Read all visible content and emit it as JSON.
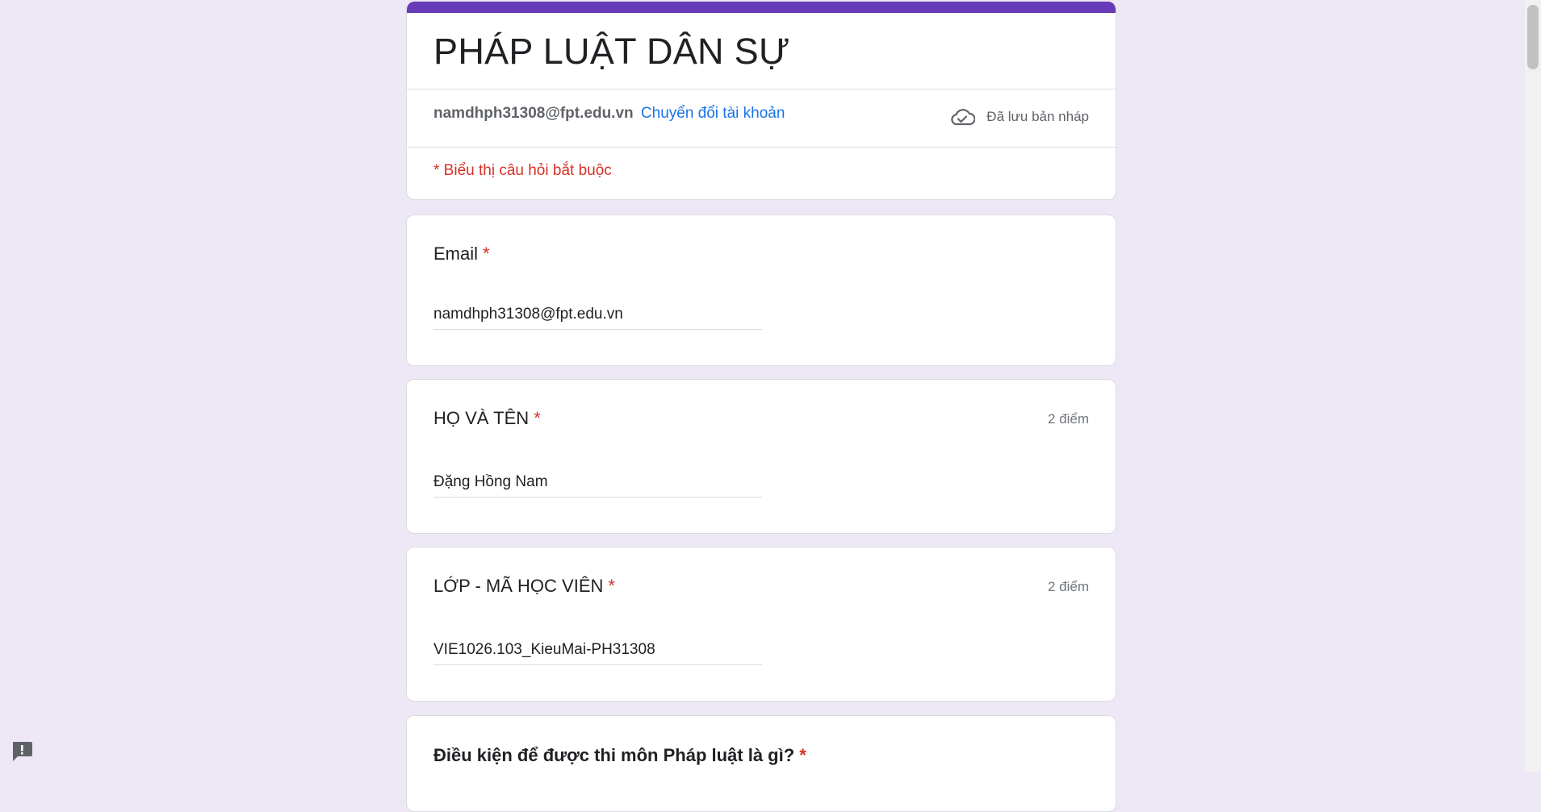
{
  "form": {
    "title": "PHÁP LUẬT DÂN SỰ",
    "account_email": "namdhph31308@fpt.edu.vn",
    "switch_account": "Chuyển đổi tài khoản",
    "draft_status": "Đã lưu bản nháp",
    "required_note": "* Biểu thị câu hỏi bắt buộc"
  },
  "questions": [
    {
      "title": "Email",
      "required_mark": "*",
      "points": "",
      "answer": "namdhph31308@fpt.edu.vn"
    },
    {
      "title": "HỌ VÀ TÊN",
      "required_mark": "*",
      "points": "2 điểm",
      "answer": "Đặng Hồng Nam"
    },
    {
      "title": "LỚP - MÃ HỌC VIÊN",
      "required_mark": "*",
      "points": "2 điểm",
      "answer": "VIE1026.103_KieuMai-PH31308"
    },
    {
      "title": "Điều kiện để được thi môn Pháp luật là gì?",
      "required_mark": "*"
    }
  ],
  "colors": {
    "theme": "#673ab7",
    "background": "#ede7f6",
    "required": "#d93025",
    "link": "#1a73e8"
  },
  "icons": {
    "draft": "cloud-check-icon",
    "feedback": "report-icon"
  }
}
